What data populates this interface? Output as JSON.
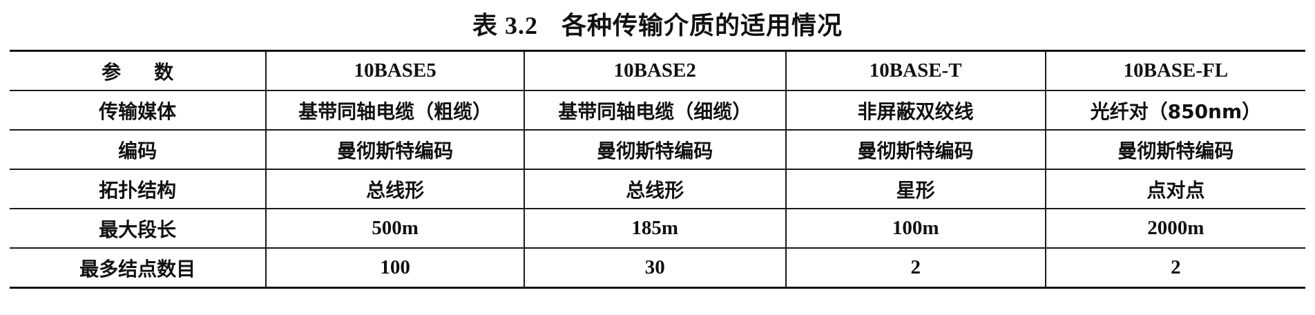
{
  "caption": {
    "number": "表 3.2",
    "title": "各种传输介质的适用情况"
  },
  "table": {
    "header": {
      "param_label": "参数",
      "columns": [
        "10BASE5",
        "10BASE2",
        "10BASE-T",
        "10BASE-FL"
      ]
    },
    "rows": [
      {
        "label": "传输媒体",
        "values": [
          "基带同轴电缆（粗缆）",
          "基带同轴电缆（细缆）",
          "非屏蔽双绞线",
          "光纤对（850nm）"
        ]
      },
      {
        "label": "编码",
        "values": [
          "曼彻斯特编码",
          "曼彻斯特编码",
          "曼彻斯特编码",
          "曼彻斯特编码"
        ]
      },
      {
        "label": "拓扑结构",
        "values": [
          "总线形",
          "总线形",
          "星形",
          "点对点"
        ]
      },
      {
        "label": "最大段长",
        "values": [
          "500m",
          "185m",
          "100m",
          "2000m"
        ]
      },
      {
        "label": "最多结点数目",
        "values": [
          "100",
          "30",
          "2",
          "2"
        ]
      }
    ]
  }
}
